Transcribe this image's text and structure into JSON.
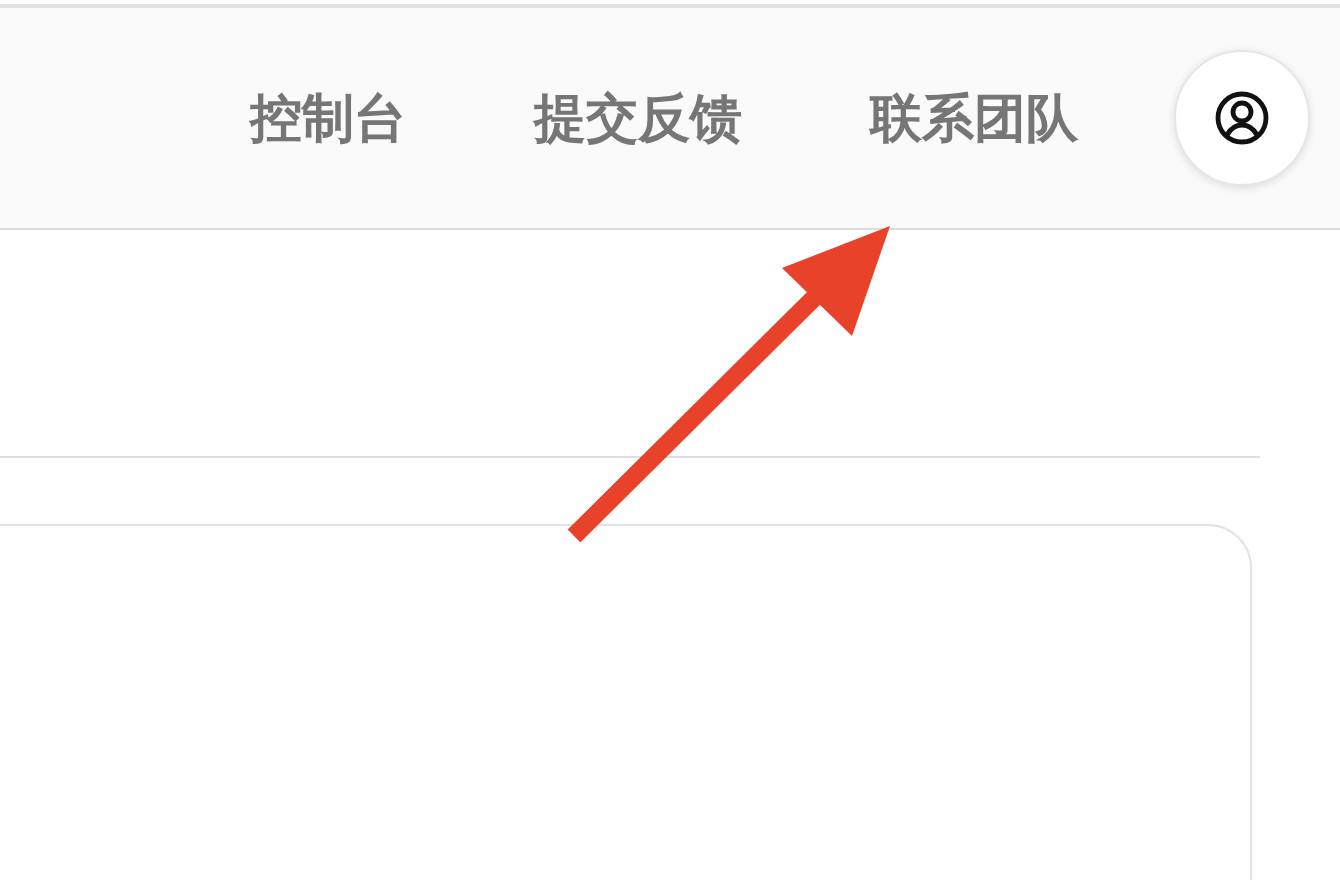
{
  "header": {
    "nav_links": [
      {
        "label": "控制台"
      },
      {
        "label": "提交反馈"
      },
      {
        "label": "联系团队"
      }
    ]
  },
  "annotation": {
    "kind": "arrow",
    "color": "#e8432a"
  }
}
